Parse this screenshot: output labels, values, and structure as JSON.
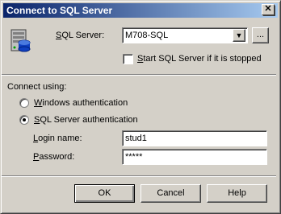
{
  "window": {
    "title": "Connect to SQL Server"
  },
  "server": {
    "label_prefix": "S",
    "label_rest": "QL Server:",
    "value": "M708-SQL",
    "browse_label": "...",
    "start_if_stopped_prefix": "S",
    "start_if_stopped_rest": "tart SQL Server if it is stopped"
  },
  "connect": {
    "heading": "Connect using:",
    "windows_auth_prefix": "W",
    "windows_auth_rest": "indows authentication",
    "sql_auth_prefix": "S",
    "sql_auth_rest": "QL Server authentication",
    "login_label_prefix": "L",
    "login_label_rest": "ogin name:",
    "login_value": "stud1",
    "password_label_prefix": "P",
    "password_label_rest": "assword:",
    "password_value": "*****"
  },
  "buttons": {
    "ok": "OK",
    "cancel": "Cancel",
    "help": "Help"
  },
  "colors": {
    "titlebar_start": "#0a246a",
    "titlebar_end": "#a6caf0",
    "face": "#d4d0c8"
  }
}
